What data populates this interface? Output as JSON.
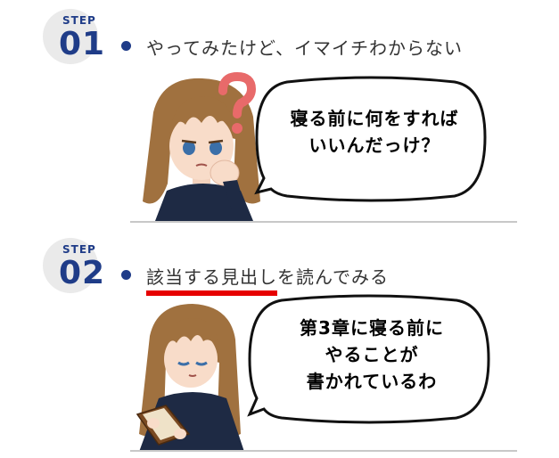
{
  "steps": [
    {
      "label": "STEP",
      "number": "01",
      "heading": "やってみたけど、イマイチわからない",
      "bubble": "寝る前に何をすれば\nいいんだっけ？"
    },
    {
      "label": "STEP",
      "number": "02",
      "heading_highlight": "該当する見出し",
      "heading_rest": "を読んでみる",
      "bubble": "第3章に寝る前に\nやることが\n書かれているわ"
    }
  ],
  "colors": {
    "accent": "#1f3c88",
    "highlight_underline": "#e60000",
    "question_mark": "#e86a6a",
    "hair": "#a0713f"
  }
}
